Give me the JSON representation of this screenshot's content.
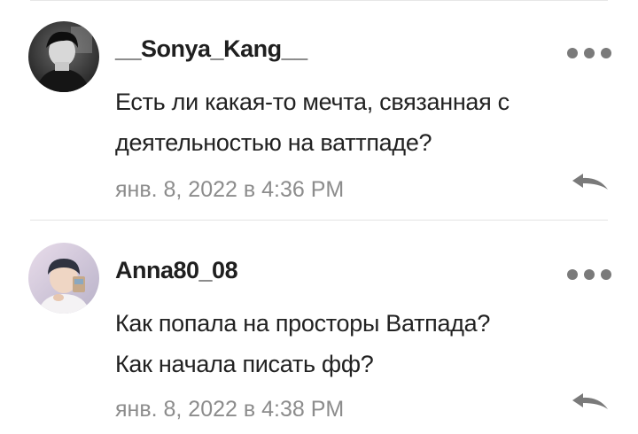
{
  "colors": {
    "username": "#1f1f1f",
    "text": "#222222",
    "timestamp": "#8c8c8c",
    "icon": "#7a7a7a",
    "divider": "#e3e3e3"
  },
  "comments": [
    {
      "username": "__Sonya_Kang__",
      "lines": [
        "Есть ли какая-то мечта, связанная с",
        "деятельностью на ваттпаде?"
      ],
      "timestamp": "янв. 8, 2022 в 4:36 PM",
      "avatar_icon": "user-photo-avatar",
      "more_icon": "more-dots-icon",
      "reply_icon": "reply-arrow-icon"
    },
    {
      "username": "Anna80_08",
      "lines": [
        "Как попала на просторы Ватпада?",
        "Как начала писать фф?"
      ],
      "timestamp": "янв. 8, 2022 в 4:38 PM",
      "avatar_icon": "user-photo-avatar",
      "more_icon": "more-dots-icon",
      "reply_icon": "reply-arrow-icon"
    }
  ]
}
